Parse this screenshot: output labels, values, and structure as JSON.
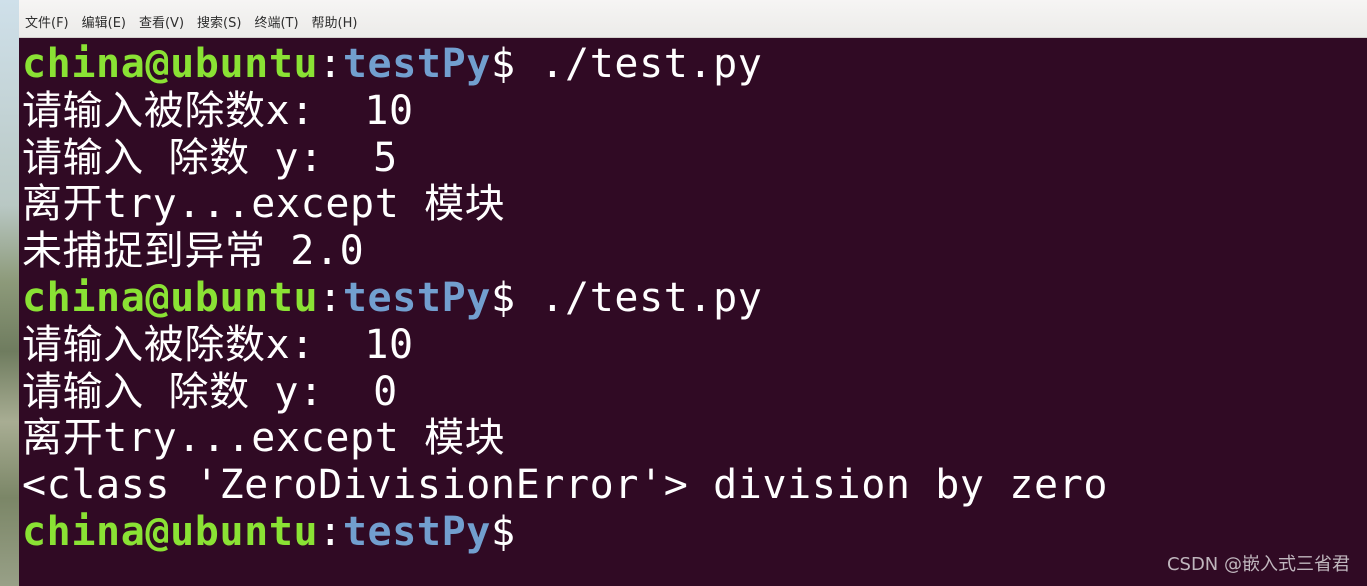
{
  "menubar": {
    "items": [
      "文件(F)",
      "编辑(E)",
      "查看(V)",
      "搜索(S)",
      "终端(T)",
      "帮助(H)"
    ]
  },
  "terminal": {
    "prompt_user": "china@ubuntu",
    "prompt_colon": ":",
    "prompt_path": "testPy",
    "prompt_dollar": "$",
    "command": " ./test.py",
    "run1": {
      "line1": "请输入被除数x:  10",
      "line2": "请输入 除数 y:  5",
      "line3": "离开try...except 模块",
      "line4": "未捕捉到异常 2.0"
    },
    "run2": {
      "line1": "请输入被除数x:  10",
      "line2": "请输入 除数 y:  0",
      "line3": "离开try...except 模块",
      "line4": "<class 'ZeroDivisionError'> division by zero"
    }
  },
  "watermark": "CSDN @嵌入式三省君",
  "colors": {
    "background": "#300a24",
    "prompt_user": "#8ae234",
    "prompt_path": "#729fcf",
    "text": "#ffffff"
  }
}
